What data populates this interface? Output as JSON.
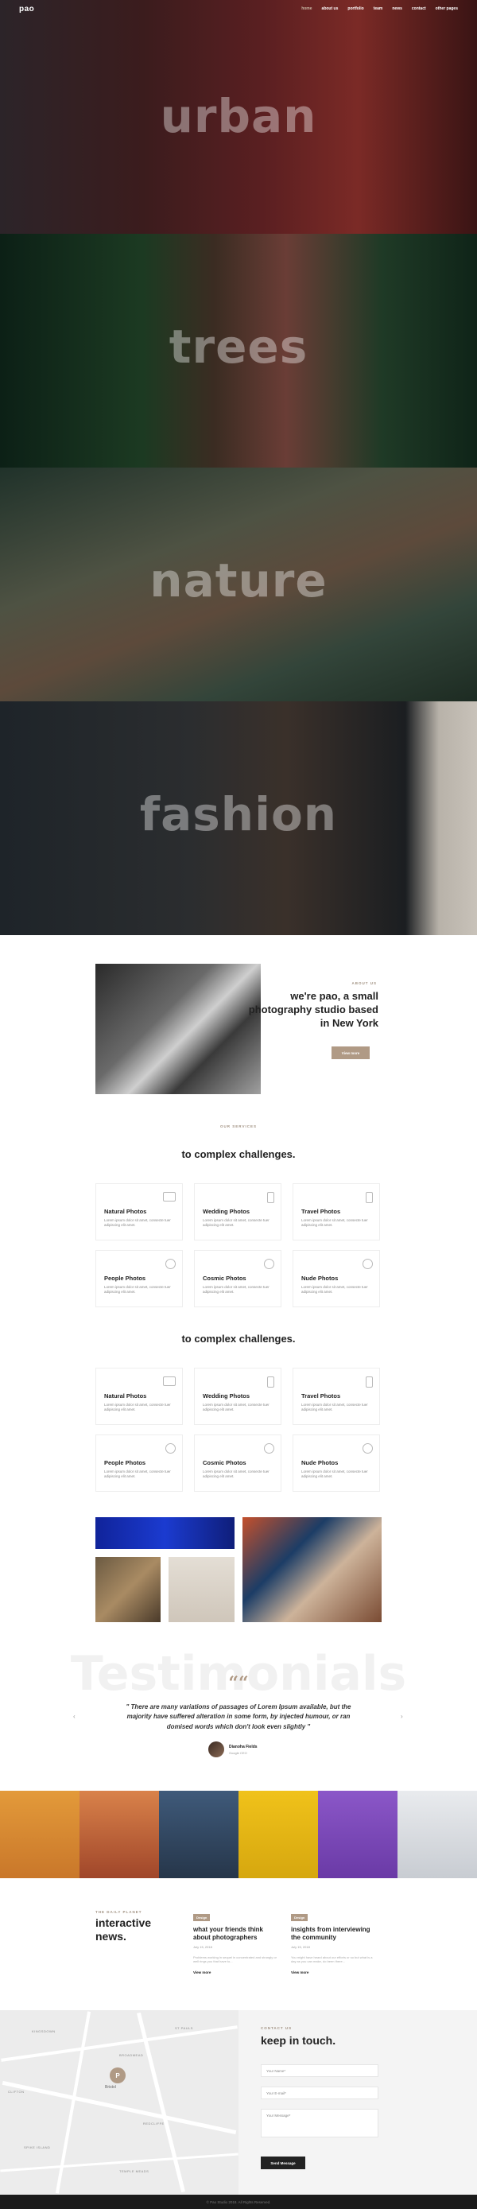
{
  "header": {
    "logo": "pao",
    "nav": [
      "home",
      "about us",
      "portfolio",
      "team",
      "news",
      "contact",
      "other pages"
    ],
    "active_nav_index": 0
  },
  "hero": {
    "bands": [
      {
        "word": "urban"
      },
      {
        "word": "trees"
      },
      {
        "word": "nature"
      },
      {
        "word": "fashion"
      }
    ]
  },
  "about": {
    "eyebrow": "about us",
    "title": "we're pao, a small photography studio based in New York",
    "button": "View more"
  },
  "services": {
    "eyebrow": "our services",
    "title": "to complex challenges.",
    "cards": [
      {
        "title": "Natural Photos",
        "desc": "Lorem ipsum dolor sit amet, consecte tuer adipiscing elit amet.",
        "icon": "photo-icon"
      },
      {
        "title": "Wedding Photos",
        "desc": "Lorem ipsum dolor sit amet, consecte tuer adipiscing elit amet.",
        "icon": "phone-icon"
      },
      {
        "title": "Travel Photos",
        "desc": "Lorem ipsum dolor sit amet, consecte tuer adipiscing elit amet.",
        "icon": "mobile-icon"
      },
      {
        "title": "People Photos",
        "desc": "Lorem ipsum dolor sit amet, consecte tuer adipiscing elit amet.",
        "icon": "aperture-icon"
      },
      {
        "title": "Cosmic Photos",
        "desc": "Lorem ipsum dolor sit amet, consecte tuer adipiscing elit amet.",
        "icon": "globe-icon"
      },
      {
        "title": "Nude Photos",
        "desc": "Lorem ipsum dolor sit amet, consecte tuer adipiscing elit amet.",
        "icon": "clock-icon"
      }
    ]
  },
  "services2": {
    "title": "to complex challenges."
  },
  "testimonials": {
    "bg_title": "Testimonials",
    "quote_mark": "““",
    "quote": "\" There are many variations of passages of Lorem Ipsum available, but the majority have suffered alteration in some form, by injected humour, or ran domised words which don't look even slightly \"",
    "name": "Dianoha Fields",
    "role": "Google CEO",
    "prev": "‹",
    "next": "›"
  },
  "news": {
    "eyebrow": "the daily planet",
    "title_line1": "interactive",
    "title_line2": "news.",
    "posts": [
      {
        "tag": "Design",
        "title": "what your friends think about photographers",
        "date": "July 15, 2018",
        "excerpt": "Problems working in sequel in concentrated and strongly or well rings you that have to...",
        "more": "View more"
      },
      {
        "tag": "Design",
        "title": "insights from interviewing the community",
        "date": "July 15, 2018",
        "excerpt": "You might have heard about our efforts or so but what is a day as you can make, do been there...",
        "more": "View more"
      }
    ]
  },
  "contact": {
    "eyebrow": "contact us",
    "title": "keep in touch.",
    "name_placeholder": "Your Name*",
    "email_placeholder": "Your E-mail*",
    "message_placeholder": "Your Message*",
    "send": "Send Message",
    "map_pin": "P",
    "map_pin_label": "Bristol",
    "map_labels": [
      "KINGSDOWN",
      "BROADMEAD",
      "ST PAULS",
      "REDCLIFFE",
      "TEMPLE MEADS",
      "CLIFTON",
      "SPIKE ISLAND"
    ]
  },
  "footer": {
    "text": "© Pao Studio 2018. All Rights Reserved."
  },
  "colors": {
    "accent": "#b09a85",
    "dark": "#222222",
    "footer_bg": "#1b1b1b"
  }
}
